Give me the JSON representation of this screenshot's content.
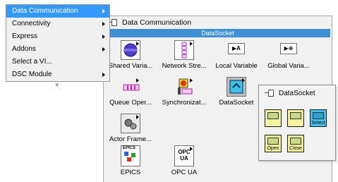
{
  "menu": {
    "items": [
      {
        "label": "Data Communication",
        "selected": true,
        "has_arrow": true
      },
      {
        "label": "Connectivity",
        "selected": false,
        "has_arrow": true
      },
      {
        "label": "Express",
        "selected": false,
        "has_arrow": true
      },
      {
        "label": "Addons",
        "selected": false,
        "has_arrow": true
      },
      {
        "label": "Select a VI...",
        "selected": false,
        "has_arrow": false
      },
      {
        "label": "DSC Module",
        "selected": false,
        "has_arrow": true
      }
    ],
    "more_glyph": "»"
  },
  "palette": {
    "title": "Data Communication",
    "subheader": "DataSocket",
    "items": [
      {
        "label": "Shared Varia...",
        "icon": "shared-variable-icon"
      },
      {
        "label": "Network Stre...",
        "icon": "network-stream-icon"
      },
      {
        "label": "Local Variable",
        "icon": "local-variable-icon"
      },
      {
        "label": "Global Varia...",
        "icon": "global-variable-icon"
      },
      {
        "label": "Queue Oper...",
        "icon": "queue-operations-icon"
      },
      {
        "label": "Synchronizat...",
        "icon": "synchronization-icon"
      },
      {
        "label": "DataSocket",
        "icon": "datasocket-icon"
      },
      {
        "label": "Actor Frame...",
        "icon": "actor-framework-icon"
      },
      {
        "label": "EPICS",
        "icon": "epics-icon"
      },
      {
        "label": "OPC UA",
        "icon": "opc-ua-icon"
      }
    ],
    "icon_text": {
      "local_variable": "▶A",
      "global_variable": "▶⊕",
      "epics": "EPICS",
      "opc": "OPC",
      "ua": "UA"
    }
  },
  "datasocket": {
    "title": "DataSocket",
    "buttons": [
      {
        "label": "",
        "icon": "ds-read-icon"
      },
      {
        "label": "",
        "icon": "ds-write-icon"
      },
      {
        "label": "Select",
        "icon": "ds-select-icon"
      },
      {
        "label": "Open",
        "icon": "ds-open-icon"
      },
      {
        "label": "Close",
        "icon": "ds-close-icon"
      }
    ]
  }
}
